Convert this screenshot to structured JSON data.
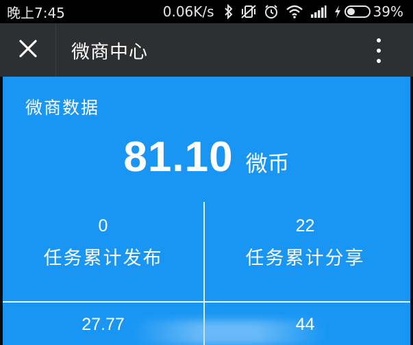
{
  "status_bar": {
    "time": "晚上7:45",
    "net_speed": "0.06K/s",
    "battery_percent": "39%",
    "battery_level": 0.39,
    "icons": [
      "bluetooth-icon",
      "vibrate-off-icon",
      "alarm-icon",
      "wifi-icon",
      "signal-icon",
      "charging-icon",
      "battery-icon"
    ]
  },
  "title_bar": {
    "title": "微商中心",
    "icons": [
      "close-icon",
      "more-vertical-icon"
    ]
  },
  "main": {
    "section_title": "微商数据",
    "balance_value": "81.10",
    "balance_unit": "微币",
    "background_color": "#1996f4",
    "stats": [
      {
        "value": "0",
        "label": "任务累计发布"
      },
      {
        "value": "22",
        "label": "任务累计分享"
      },
      {
        "value": "27.77",
        "label": ""
      },
      {
        "value": "44",
        "label": ""
      }
    ]
  }
}
